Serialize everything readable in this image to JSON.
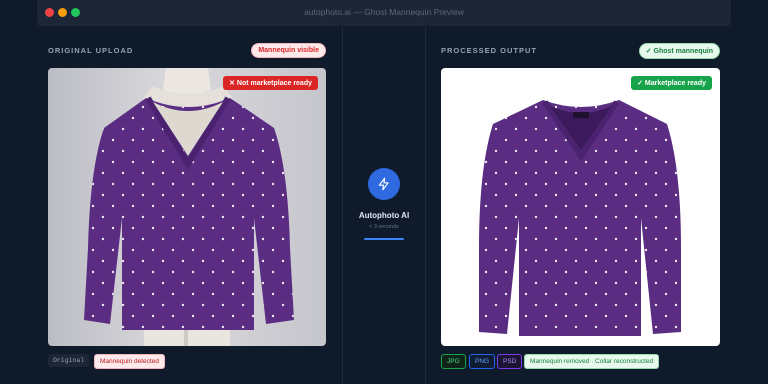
{
  "window": {
    "title": "autophoto.ai — Ghost Mannequin Preview"
  },
  "left": {
    "section_label": "ORIGINAL UPLOAD",
    "header_pill": "Mannequin visible",
    "status_badge": "✕ Not marketplace ready",
    "footer_tags": [
      "Original",
      "Mannequin detected"
    ]
  },
  "center": {
    "icon": "lightning-bolt-icon",
    "title": "Autophoto AI",
    "subtitle": "< 3 seconds"
  },
  "right": {
    "section_label": "PROCESSED OUTPUT",
    "header_pill": "✓ Ghost mannequin",
    "status_badge": "✓ Marketplace ready",
    "formats": [
      "JPG",
      "PNG",
      "PSD"
    ],
    "result_tag": "Mannequin removed · Collar reconstructed"
  },
  "colors": {
    "accent": "#2f6ae0",
    "sweater": "#5b2d82",
    "danger": "#dc2626",
    "success": "#16a34a"
  }
}
